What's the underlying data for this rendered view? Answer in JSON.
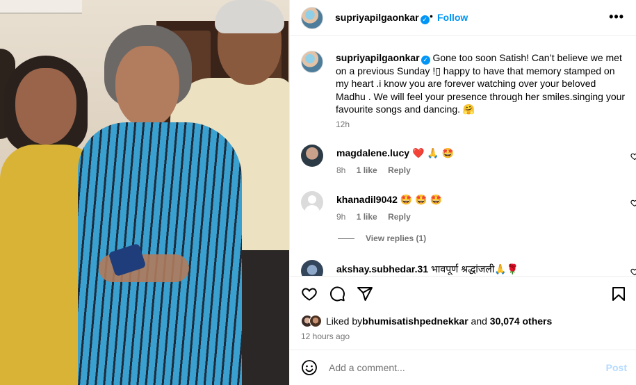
{
  "post": {
    "username": "supriyapilgaonkar",
    "verified": true,
    "separator": "•",
    "follow_label": "Follow",
    "more_label": "•••"
  },
  "caption": {
    "username": "supriyapilgaonkar",
    "text": "Gone too soon Satish! Can’t believe we met on a previous Sunday !▯ happy to have that memory stamped on my heart .i know you are forever watching over your beloved Madhu . We will feel your presence through her smiles.singing your favourite songs and dancing. 🤗",
    "time": "12h"
  },
  "comments": [
    {
      "username": "magdalene.lucy",
      "text": "❤️ 🙏 🤩",
      "time": "8h",
      "likes": "1 like",
      "reply": "Reply"
    },
    {
      "username": "khanadil9042",
      "text": "🤩 🤩 🤩",
      "time": "9h",
      "likes": "1 like",
      "reply": "Reply"
    },
    {
      "username": "akshay.subhedar.31",
      "text": "भावपूर्ण श्रद्धांजली🙏🌹",
      "time": "",
      "likes": "",
      "reply": ""
    }
  ],
  "view_replies": "View replies (1)",
  "likes": {
    "prefix": "Liked by ",
    "user": "bhumisatishpednekkar",
    "middle": " and ",
    "others": "30,074 others"
  },
  "posted_ago": "12 hours ago",
  "composer": {
    "placeholder": "Add a comment...",
    "post_label": "Post"
  },
  "icons": {
    "like": "heart-icon",
    "comment": "comment-icon",
    "share": "share-icon",
    "save": "bookmark-icon",
    "emoji": "emoji-icon",
    "more": "more-icon"
  },
  "colors": {
    "link_blue": "#0095f6",
    "post_disabled": "#b3dbff",
    "muted_text": "#737373"
  }
}
